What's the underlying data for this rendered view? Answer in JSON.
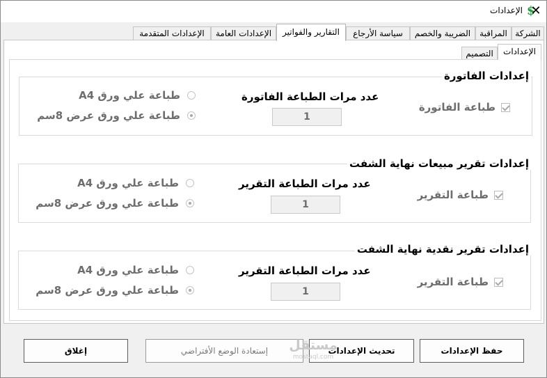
{
  "window": {
    "title": "الإعدادات",
    "close_glyph": "✕",
    "app_icon": "$"
  },
  "tabs": [
    {
      "label": "الشركة"
    },
    {
      "label": "المراقبة"
    },
    {
      "label": "الضريبة والخصم"
    },
    {
      "label": "سياسة الأرجاع"
    },
    {
      "label": "التقارير والفواتير",
      "active": true
    },
    {
      "label": "الإعدادات العامة"
    },
    {
      "label": "الإعدادات المتقدمة"
    }
  ],
  "subtabs": [
    {
      "label": "الإعدادات",
      "active": true
    },
    {
      "label": "التصميم"
    }
  ],
  "groups": [
    {
      "title": "إعدادات الفاتورة",
      "checkbox_label": "طباعة الفاتورة",
      "count_label": "عدد مرات الطباعة الفاتورة",
      "count_value": "1",
      "radio_a4": "طباعة علي ورق A4",
      "radio_8cm": "طباعة علي ورق عرض 8سم"
    },
    {
      "title": "إعدادات تقرير مبيعات نهاية الشفت",
      "checkbox_label": "طباعة التقرير",
      "count_label": "عدد مرات الطباعة التقرير",
      "count_value": "1",
      "radio_a4": "طباعة علي ورق A4",
      "radio_8cm": "طباعة علي ورق عرض 8سم"
    },
    {
      "title": "إعدادات تقرير نقدية نهاية الشفت",
      "checkbox_label": "طباعة التقرير",
      "count_label": "عدد مرات الطباعة التقرير",
      "count_value": "1",
      "radio_a4": "طباعة علي ورق A4",
      "radio_8cm": "طباعة علي ورق عرض 8سم"
    }
  ],
  "buttons": {
    "save": "حفظ الإعدادات",
    "update": "تحديث الإعدادات",
    "restore": "إستعادة الوضع الأفتراضي",
    "close": "إغلاق"
  },
  "watermark": {
    "line1": "مستقل",
    "line2": "mostaql.com"
  },
  "colors": {
    "accent_icon": "#1d9e3a",
    "disabled_text": "#6d6d6d"
  }
}
